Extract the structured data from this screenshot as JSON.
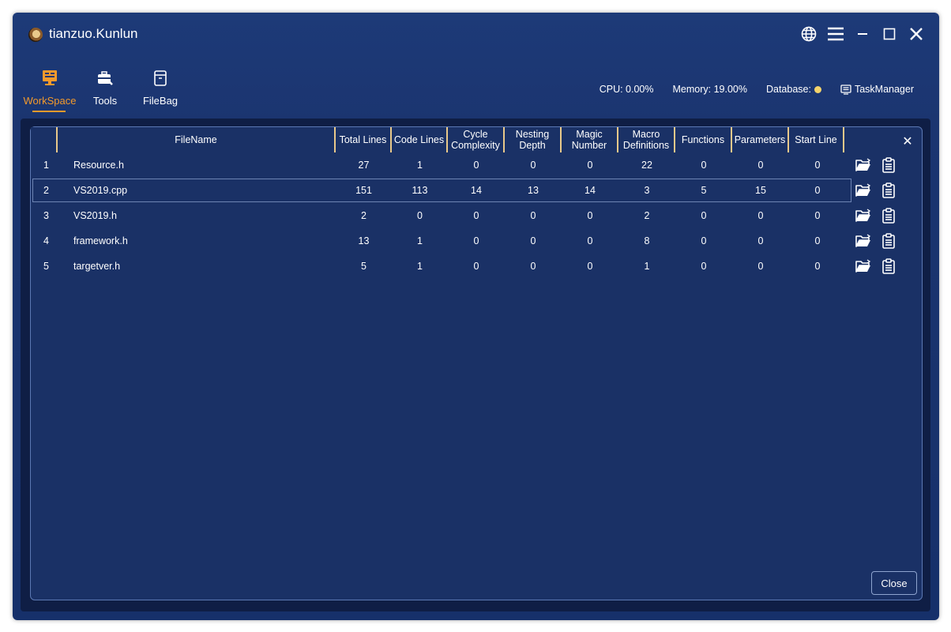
{
  "app": {
    "title": "tianzuo.Kunlun"
  },
  "nav": [
    {
      "label": "WorkSpace",
      "icon": "workspace-icon",
      "active": true
    },
    {
      "label": "Tools",
      "icon": "toolbox-icon",
      "active": false
    },
    {
      "label": "FileBag",
      "icon": "filebag-icon",
      "active": false
    }
  ],
  "status": {
    "cpu": "CPU: 0.00%",
    "memory": "Memory: 19.00%",
    "database": "Database:",
    "taskmanager": "TaskManager"
  },
  "table": {
    "headers": [
      "FileName",
      "Total Lines",
      "Code Lines",
      "Cycle Complexity",
      "Nesting Depth",
      "Magic Number",
      "Macro Definitions",
      "Functions",
      "Parameters",
      "Start Line"
    ],
    "rows": [
      {
        "index": "1",
        "filename": "Resource.h",
        "total_lines": "27",
        "code_lines": "1",
        "cycle_complexity": "0",
        "nesting_depth": "0",
        "magic_number": "0",
        "macro_definitions": "22",
        "functions": "0",
        "parameters": "0",
        "start_line": "0"
      },
      {
        "index": "2",
        "filename": "VS2019.cpp",
        "total_lines": "151",
        "code_lines": "113",
        "cycle_complexity": "14",
        "nesting_depth": "13",
        "magic_number": "14",
        "macro_definitions": "3",
        "functions": "5",
        "parameters": "15",
        "start_line": "0"
      },
      {
        "index": "3",
        "filename": "VS2019.h",
        "total_lines": "2",
        "code_lines": "0",
        "cycle_complexity": "0",
        "nesting_depth": "0",
        "magic_number": "0",
        "macro_definitions": "2",
        "functions": "0",
        "parameters": "0",
        "start_line": "0"
      },
      {
        "index": "4",
        "filename": "framework.h",
        "total_lines": "13",
        "code_lines": "1",
        "cycle_complexity": "0",
        "nesting_depth": "0",
        "magic_number": "0",
        "macro_definitions": "8",
        "functions": "0",
        "parameters": "0",
        "start_line": "0"
      },
      {
        "index": "5",
        "filename": "targetver.h",
        "total_lines": "5",
        "code_lines": "1",
        "cycle_complexity": "0",
        "nesting_depth": "0",
        "magic_number": "0",
        "macro_definitions": "1",
        "functions": "0",
        "parameters": "0",
        "start_line": "0"
      }
    ],
    "selected_row": "2"
  },
  "dialog": {
    "close_label": "Close",
    "close_x": "✕"
  },
  "colors": {
    "accent": "#f39a2c",
    "background": "#1a3166",
    "header_divider": "#e8c88a",
    "db_status": "#f4d36b"
  }
}
